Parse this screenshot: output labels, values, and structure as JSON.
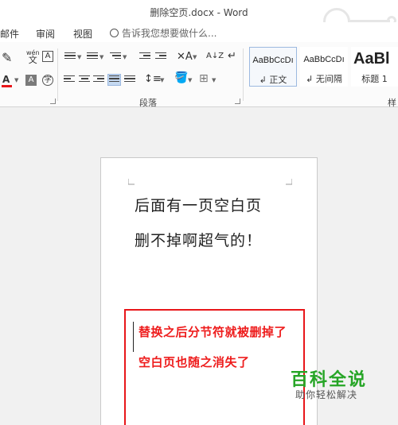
{
  "title": "删除空页.docx - Word",
  "menu": {
    "items": [
      "邮件",
      "审阅",
      "视图"
    ],
    "tell_me": "告诉我您想要做什么..."
  },
  "ribbon": {
    "font_icons": {
      "phonetic_top": "wén",
      "phonetic_bottom": "文",
      "char_border": "A",
      "font_color": "A",
      "char_shading": "A",
      "enclose": "字",
      "clear_format": "A",
      "sort": "A↓Z",
      "show_marks": "↵"
    },
    "paragraph_group": "段落",
    "styles": [
      {
        "preview": "AaBbCcDı",
        "name": "↲ 正文"
      },
      {
        "preview": "AaBbCcDı",
        "name": "↲ 无间隔"
      },
      {
        "preview": "AaBl",
        "name": "标题 1"
      }
    ],
    "styles_group": "样"
  },
  "document": {
    "lines": [
      "后面有一页空白页",
      "删不掉啊超气的！"
    ]
  },
  "annotation": {
    "line1": "替换之后分节符就被删掉了",
    "line2": "空白页也随之消失了"
  },
  "watermark": {
    "main": "百科全说",
    "sub": "助你轻松解决"
  },
  "colors": {
    "accent": "#2b579a",
    "annotation": "#ee1c1c",
    "watermark": "#26a526"
  }
}
